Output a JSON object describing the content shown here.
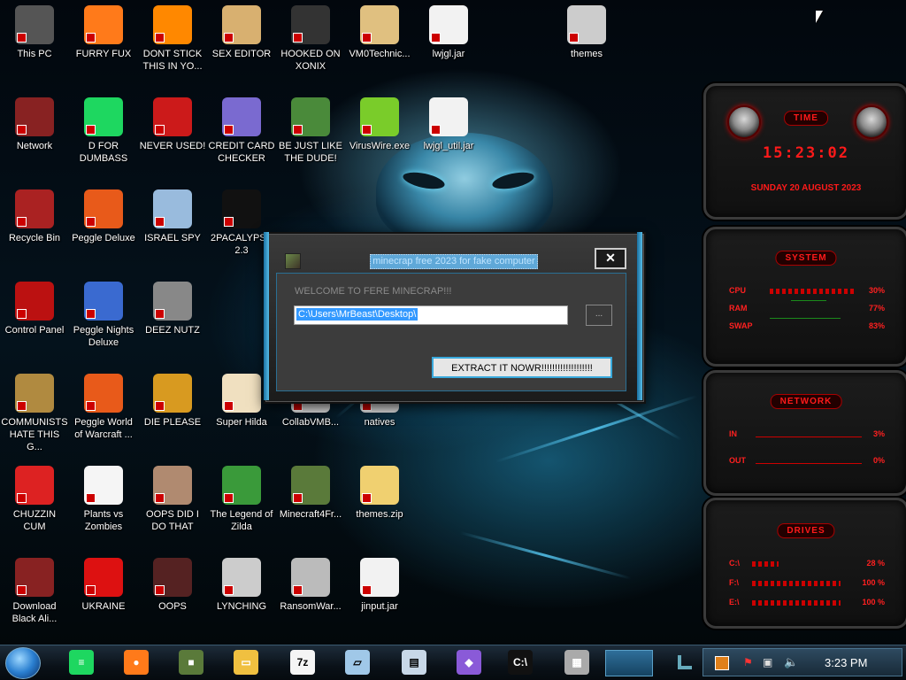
{
  "desktop": {
    "icons": [
      {
        "label": "This PC",
        "icon": "computer-icon",
        "color": "#555555"
      },
      {
        "label": "FURRY FUX",
        "icon": "firefox-icon",
        "color": "#ff7a1a"
      },
      {
        "label": "DONT STICK THIS IN YO...",
        "icon": "vlc-cone-icon",
        "color": "#ff8800"
      },
      {
        "label": "SEX EDITOR",
        "icon": "hxd-editor-icon",
        "color": "#d8b070"
      },
      {
        "label": "HOOKED ON XONIX",
        "icon": "maze-game-icon",
        "color": "#333333"
      },
      {
        "label": "VM0Technic...",
        "icon": "doctor-icon",
        "color": "#e0c080"
      },
      {
        "label": "lwjgl.jar",
        "icon": "java-jar-icon",
        "color": "#f2f2f2"
      },
      {
        "label": "themes",
        "icon": "themes-folder-icon",
        "color": "#cccccc"
      },
      {
        "label": "Network",
        "icon": "alien-network-icon",
        "color": "#882222"
      },
      {
        "label": "D FOR DUMBASS",
        "icon": "spotify-icon",
        "color": "#1ed760"
      },
      {
        "label": "NEVER USED!",
        "icon": "dev-cpp-icon",
        "color": "#cc1a1a"
      },
      {
        "label": "CREDIT CARD CHECKER",
        "icon": "credit-card-icon",
        "color": "#7a6ad0"
      },
      {
        "label": "BE JUST LIKE THE DUDE!",
        "icon": "dude-game-icon",
        "color": "#4a8a3a"
      },
      {
        "label": "VirusWire.exe",
        "icon": "lime-icon",
        "color": "#7acc2a"
      },
      {
        "label": "lwjgl_util.jar",
        "icon": "java-jar-icon",
        "color": "#f2f2f2"
      },
      {
        "label": "Recycle Bin",
        "icon": "recycle-bin-icon",
        "color": "#aa2222"
      },
      {
        "label": "Peggle Deluxe",
        "icon": "peggle-icon",
        "color": "#e85a1a"
      },
      {
        "label": "ISRAEL SPY",
        "icon": "network-spy-icon",
        "color": "#99bbdd"
      },
      {
        "label": "2PACALYPSE 2.3",
        "icon": "terminal-icon",
        "color": "#111111"
      },
      {
        "label": "Control Panel",
        "icon": "control-panel-icon",
        "color": "#bb1111"
      },
      {
        "label": "Peggle Nights Deluxe",
        "icon": "peggle-nights-icon",
        "color": "#3a6ad0"
      },
      {
        "label": "DEEZ NUTZ",
        "icon": "windows-stack-icon",
        "color": "#888888"
      },
      {
        "label": "COMMUNISTS HATE THIS G...",
        "icon": "money-bag-icon",
        "color": "#b08a40"
      },
      {
        "label": "Peggle World of Warcraft ...",
        "icon": "peggle-wow-icon",
        "color": "#e85a1a"
      },
      {
        "label": "DIE PLEASE",
        "icon": "de-icon",
        "color": "#d89a20"
      },
      {
        "label": "Super Hilda",
        "icon": "pixel-character-icon",
        "color": "#f0e0c0"
      },
      {
        "label": "CollabVMB...",
        "icon": "collabvm-icon",
        "color": "#dddddd"
      },
      {
        "label": "natives",
        "icon": "folder-icon",
        "color": "#dddddd"
      },
      {
        "label": "CHUZZIN CUM",
        "icon": "chuzzle-icon",
        "color": "#dd2222"
      },
      {
        "label": "Plants vs Zombies",
        "icon": "flower-icon",
        "color": "#f5f5f5"
      },
      {
        "label": "OOPS DID I DO THAT",
        "icon": "portrait-icon",
        "color": "#b08a70"
      },
      {
        "label": "The Legend of Zilda",
        "icon": "zelda-icon",
        "color": "#3a9a3a"
      },
      {
        "label": "Minecraft4Fr...",
        "icon": "minecraft-grass-icon",
        "color": "#5a7a3a"
      },
      {
        "label": "themes.zip",
        "icon": "zip-folder-icon",
        "color": "#f0d070"
      },
      {
        "label": "Download Black Ali...",
        "icon": "alien-download-icon",
        "color": "#882222"
      },
      {
        "label": "UKRAINE",
        "icon": "radiation-icon",
        "color": "#dd1111"
      },
      {
        "label": "OOPS",
        "icon": "alien-mask-icon",
        "color": "#552222"
      },
      {
        "label": "LYNCHING",
        "icon": "noose-icon",
        "color": "#cccccc"
      },
      {
        "label": "RansomWar...",
        "icon": "skull-ring-icon",
        "color": "#bbbbbb"
      },
      {
        "label": "jinput.jar",
        "icon": "java-jar-icon",
        "color": "#f2f2f2"
      }
    ]
  },
  "dialog": {
    "title": "minecrap free 2023 for fake computer",
    "close_label": "✕",
    "welcome": "WELCOME TO FERE MINECRAP!!!",
    "path_value": "C:\\Users\\MrBeast\\Desktop\\",
    "browse_label": "...",
    "extract_label": "EXTRACT IT NOWR!!!!!!!!!!!!!!!!!!!"
  },
  "gadgets": {
    "time": {
      "label": "TIME",
      "clock": "15:23:02",
      "date": "SUNDAY 20 AUGUST 2023"
    },
    "system": {
      "label": "SYSTEM",
      "rows": [
        {
          "name": "CPU",
          "value": "30%"
        },
        {
          "name": "RAM",
          "value": "77%"
        },
        {
          "name": "SWAP",
          "value": "83%"
        }
      ]
    },
    "network": {
      "label": "NETWORK",
      "rows": [
        {
          "name": "IN",
          "value": "3%"
        },
        {
          "name": "OUT",
          "value": "0%"
        }
      ]
    },
    "drives": {
      "label": "DRIVES",
      "rows": [
        {
          "name": "C:\\",
          "value": "28 %"
        },
        {
          "name": "F:\\",
          "value": "100 %"
        },
        {
          "name": "E:\\",
          "value": "100 %"
        }
      ]
    }
  },
  "taskbar": {
    "items": [
      {
        "icon": "spotify-icon",
        "color": "#1ed760",
        "glyph": "≡"
      },
      {
        "icon": "firefox-icon",
        "color": "#ff7a1a",
        "glyph": "●"
      },
      {
        "icon": "minecraft-grass-icon",
        "color": "#5a7a3a",
        "glyph": "■"
      },
      {
        "icon": "file-explorer-icon",
        "color": "#f0c040",
        "glyph": "▭"
      },
      {
        "icon": "7zip-icon",
        "color": "#f5f5f5",
        "glyph": "7z"
      },
      {
        "icon": "notepad-icon",
        "color": "#a0c8e8",
        "glyph": "▱"
      },
      {
        "icon": "performance-monitor-icon",
        "color": "#c8d8e8",
        "glyph": "▤"
      },
      {
        "icon": "visual-studio-icon",
        "color": "#8a5ad8",
        "glyph": "◆"
      },
      {
        "icon": "command-prompt-icon",
        "color": "#111111",
        "glyph": "C:\\"
      },
      {
        "icon": "wall-app-icon",
        "color": "#aaaaaa",
        "glyph": "▦"
      }
    ],
    "time": "3:23 PM"
  }
}
